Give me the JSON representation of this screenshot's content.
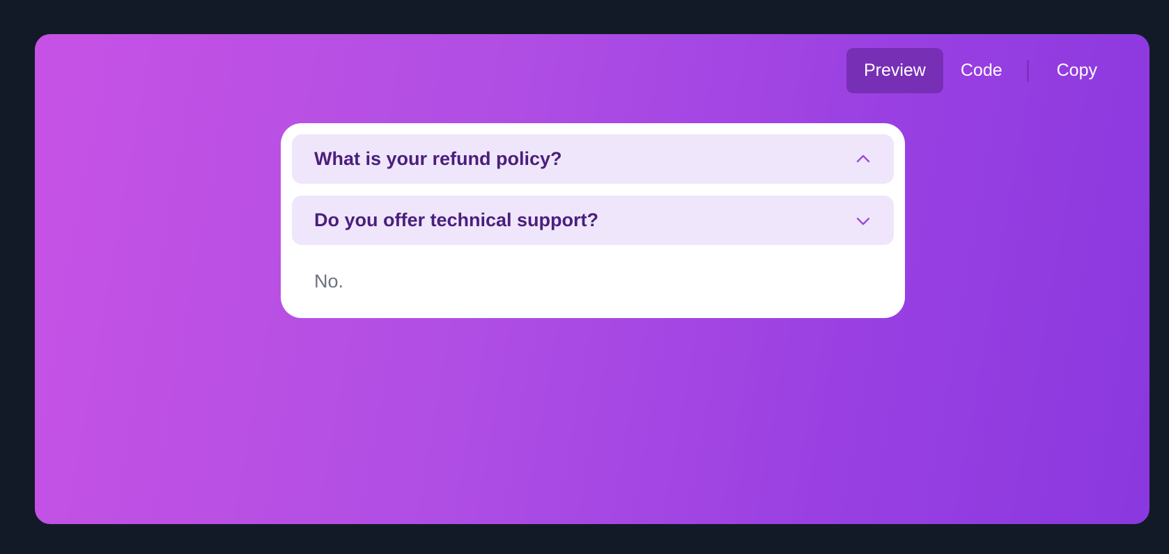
{
  "toolbar": {
    "preview_label": "Preview",
    "code_label": "Code",
    "copy_label": "Copy",
    "active_tab": "Preview"
  },
  "accordion": {
    "items": [
      {
        "question": "What is your refund policy?",
        "expanded": false,
        "icon": "chevron-up-icon"
      },
      {
        "question": "Do you offer technical support?",
        "expanded": true,
        "icon": "chevron-down-icon"
      }
    ],
    "answer": "No."
  },
  "colors": {
    "page_bg": "#131a27",
    "gradient_start": "#c752e5",
    "gradient_end": "#8a38df",
    "active_tab_bg": "#772fb6",
    "item_bg": "#efe6fb",
    "question_text": "#4a1f7c",
    "chevron": "#9b47e0",
    "answer_text": "#6b7280"
  }
}
